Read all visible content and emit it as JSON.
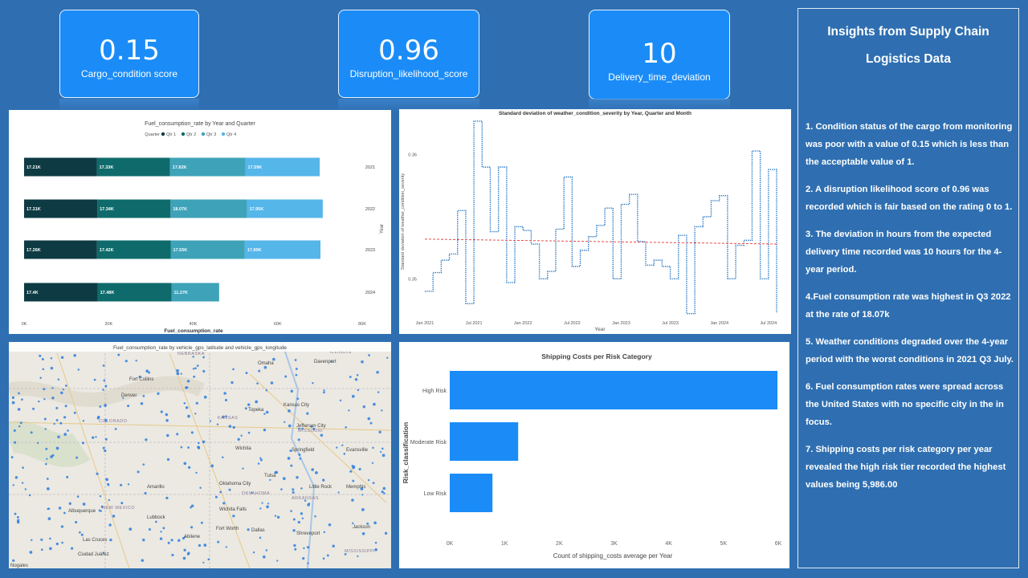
{
  "kpis": [
    {
      "value": "0.15",
      "label": "Cargo_condition score"
    },
    {
      "value": "0.96",
      "label": "Disruption_likelihood_score"
    },
    {
      "value": "10",
      "label": "Delivery_time_deviation"
    }
  ],
  "insights": {
    "title_line1": "Insights from Supply Chain",
    "title_line2": "Logistics Data",
    "items": [
      "1. Condition  status of the cargo from monitoring was poor  with a value of 0.15 which is less than the acceptable value of 1.",
      "2. A disruption  likelihood  score of 0.96 was recorded  which is fair based on the rating  0 to 1.",
      "3. The deviation in hours  from the expected delivery time recorded  was 10 hours  for the 4-year period.",
      "4.Fuel consumption  rate was highest in Q3 2022 at the rate of 18.07k",
      "5. Weather conditions  degraded over the 4-year period with the worst conditions  in  2021 Q3 July.",
      "6. Fuel consumption  rates were spread across the United States with no specific city in the in focus.",
      "7. Shipping  costs per risk category per year revealed the high risk tier recorded the highest values being 5,986.00"
    ]
  },
  "fuel_chart": {
    "title": "Fuel_consumption_rate by Year and Quarter",
    "legend_title": "Quarter",
    "xlabel": "Fuel_consumption_rate",
    "ylabel": "Year",
    "colors": [
      "#0e3b43",
      "#0f6b6b",
      "#3ea3b8",
      "#55b6ea"
    ]
  },
  "weather_chart": {
    "title": "Standard deviation of weather_condition_severity by Year, Quarter and Month",
    "xlabel": "Year",
    "ylabel": "Standard deviation of weather_condition_severity",
    "line_color": "#1a6fc0",
    "trend_color": "#e53935"
  },
  "map": {
    "title": "Fuel_consumption_rate by vehicle_gps_latitude and vehicle_gps_longitude",
    "labels": [
      "NEBRASKA",
      "ILLINOIS",
      "Fort Collins",
      "Denver",
      "COLORADO",
      "KANSAS",
      "Topeka",
      "Kansas City",
      "Jefferson City",
      "MISSOURI",
      "Wichita",
      "Springfield",
      "Omaha",
      "Davenport",
      "OKLAHOMA",
      "Oklahoma City",
      "Tulsa",
      "Amarillo",
      "Albuquerque",
      "NEW MEXICO",
      "Lubbock",
      "Wichita Falls",
      "Fort Worth",
      "Dallas",
      "Abilene",
      "Shreveport",
      "Little Rock",
      "ARKANSAS",
      "Memphis",
      "Evansville",
      "Las Cruces",
      "Ciudad Juárez",
      "Nogales",
      "Jackson",
      "MISSISSIPPI"
    ]
  },
  "shipping_chart": {
    "title": "Shipping Costs per Risk Category",
    "xlabel": "Count of shipping_costs average per Year",
    "ylabel": "Risk_classification",
    "color": "#1b8cf7"
  },
  "chart_data": [
    {
      "type": "bar",
      "orientation": "horizontal-stacked",
      "title": "Fuel_consumption_rate by Year and Quarter",
      "xlabel": "Fuel_consumption_rate",
      "ylabel": "Year",
      "legend_title": "Quarter",
      "legend_position": "top",
      "categories": [
        "2021",
        "2022",
        "2023",
        "2024"
      ],
      "series": [
        {
          "name": "Qtr 1",
          "values": [
            17.21,
            17.31,
            17.26,
            17.4
          ],
          "labels": [
            "17.21K",
            "17.31K",
            "17.26K",
            "17.4K"
          ]
        },
        {
          "name": "Qtr 2",
          "values": [
            17.33,
            17.34,
            17.42,
            17.48
          ],
          "labels": [
            "17.33K",
            "17.34K",
            "17.42K",
            "17.48K"
          ]
        },
        {
          "name": "Qtr 3",
          "values": [
            17.82,
            18.07,
            17.55,
            11.27
          ],
          "labels": [
            "17.82K",
            "18.07K",
            "17.55K",
            "11.27K"
          ]
        },
        {
          "name": "Qtr 4",
          "values": [
            17.59,
            17.95,
            17.89,
            0
          ],
          "labels": [
            "17.59K",
            "17.95K",
            "17.89K",
            ""
          ]
        }
      ],
      "xlim": [
        0,
        80
      ],
      "xticks": [
        "0K",
        "20K",
        "40K",
        "60K",
        "80K"
      ]
    },
    {
      "type": "line",
      "title": "Standard deviation of weather_condition_severity by Year, Quarter and Month",
      "xlabel": "Year",
      "ylabel": "Standard deviation of weather_condition_severity",
      "ylim": [
        0.3475,
        0.3625
      ],
      "yticks": [
        0.35,
        0.36
      ],
      "xticks": [
        "Jan 2021",
        "Jul 2021",
        "Jan 2022",
        "Jul 2022",
        "Jan 2023",
        "Jul 2023",
        "Jan 2024",
        "Jul 2024"
      ],
      "step": true,
      "x": [
        "2021-01",
        "2021-02",
        "2021-03",
        "2021-04",
        "2021-05",
        "2021-06",
        "2021-07",
        "2021-08",
        "2021-09",
        "2021-10",
        "2021-11",
        "2021-12",
        "2022-01",
        "2022-02",
        "2022-03",
        "2022-04",
        "2022-05",
        "2022-06",
        "2022-07",
        "2022-08",
        "2022-09",
        "2022-10",
        "2022-11",
        "2022-12",
        "2023-01",
        "2023-02",
        "2023-03",
        "2023-04",
        "2023-05",
        "2023-06",
        "2023-07",
        "2023-08",
        "2023-09",
        "2023-10",
        "2023-11",
        "2023-12",
        "2024-01",
        "2024-02",
        "2024-03",
        "2024-04",
        "2024-05",
        "2024-06",
        "2024-07",
        "2024-08"
      ],
      "series": [
        {
          "name": "",
          "values": [
            0.349,
            0.3505,
            0.3515,
            0.352,
            0.3555,
            0.348,
            0.3627,
            0.359,
            0.3538,
            0.359,
            0.3497,
            0.3542,
            0.3539,
            0.3528,
            0.35,
            0.3506,
            0.354,
            0.3582,
            0.351,
            0.3523,
            0.3534,
            0.3543,
            0.3557,
            0.35,
            0.356,
            0.3568,
            0.353,
            0.3511,
            0.3515,
            0.351,
            0.35,
            0.3535,
            0.3472,
            0.3542,
            0.355,
            0.3563,
            0.3567,
            0.35,
            0.3527,
            0.3531,
            0.3603,
            0.35,
            0.3588,
            0.3473
          ]
        },
        {
          "name": "trend",
          "values": [
            0.3532,
            0.3528
          ]
        }
      ]
    },
    {
      "type": "bar",
      "orientation": "horizontal",
      "title": "Shipping Costs per Risk Category",
      "xlabel": "Count of shipping_costs average per Year",
      "ylabel": "Risk_classification",
      "categories": [
        "High Risk",
        "Moderate Risk",
        "Low Risk"
      ],
      "values": [
        5986,
        1250,
        780
      ],
      "xlim": [
        0,
        6000
      ],
      "xticks": [
        "0K",
        "1K",
        "2K",
        "3K",
        "4K",
        "5K",
        "6K"
      ]
    }
  ]
}
